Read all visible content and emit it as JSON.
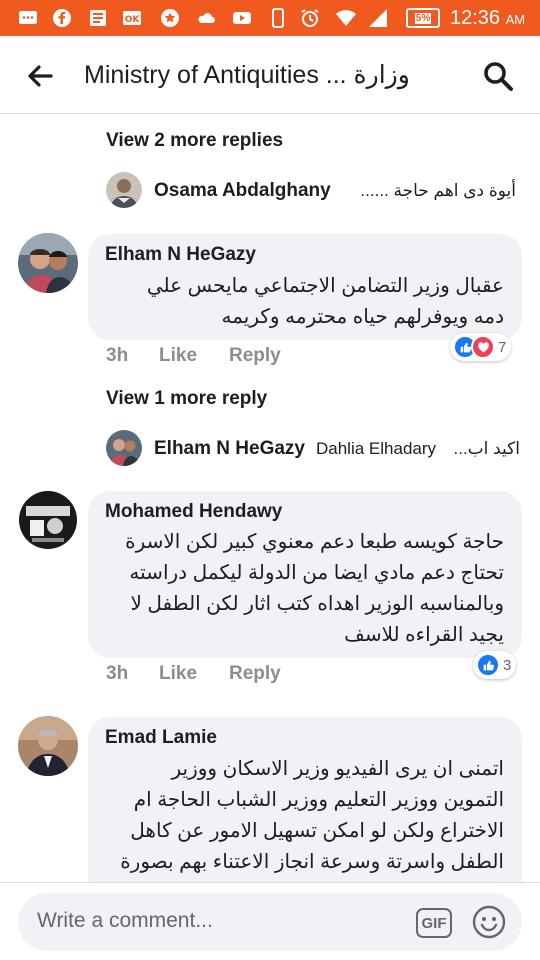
{
  "status_bar": {
    "time": "12:36",
    "ampm": "AM",
    "battery": "5%",
    "icons": [
      "message-icon",
      "facebook-icon",
      "news-icon",
      "ok-icon",
      "star-icon",
      "cloud-icon",
      "youtube-icon",
      "phone-icon",
      "alarm-icon",
      "wifi-icon",
      "signal-icon"
    ]
  },
  "header": {
    "title": "Ministry of Antiquities ... وزارة"
  },
  "thread": {
    "view_more_1": "View 2 more replies",
    "reply_1": {
      "name": "Osama Abdalghany",
      "text": "أيوة دى اهم حاجة ......"
    },
    "comment_1": {
      "name": "Elham N HeGazy",
      "lines": [
        "عقبال وزير التضامن الاجتماعي مايحس علي",
        "دمه ويوفرلهم حياه محترمه وكريمه"
      ],
      "time": "3h",
      "like": "Like",
      "reply": "Reply",
      "reaction_count": "7"
    },
    "view_more_2": "View 1 more reply",
    "reply_2": {
      "name": "Elham N HeGazy",
      "mention": "Dahlia Elhadary",
      "text": "اكيد اب..."
    },
    "comment_2": {
      "name": "Mohamed Hendawy",
      "lines": [
        "حاجة كويسه طبعا دعم معنوي كبير لكن الاسرة",
        "تحتاج دعم مادي ايضا من الدولة ليكمل دراسته",
        "وبالمناسبه الوزير اهداه كتب اثار لكن الطفل لا",
        "يجيد القراءه للاسف"
      ],
      "time": "3h",
      "like": "Like",
      "reply": "Reply",
      "reaction_count": "3"
    },
    "comment_3": {
      "name": "Emad Lamie",
      "lines": [
        "اتمنى ان يرى الفيديو وزير الاسكان ووزير",
        "التموين ووزير التعليم ووزير الشباب الحاجة ام",
        "الاختراع ولكن لو امكن تسهيل الامور عن كاهل",
        "الطفل واسرتة وسرعة انجاز الاعتناء بهم بصورة"
      ]
    }
  },
  "composer": {
    "placeholder": "Write a comment...",
    "gif_label": "GIF"
  },
  "colors": {
    "status_bar": "#f05a1e",
    "bubble": "#f0f2f5",
    "like_blue": "#1877f2",
    "love_red": "#f33e58",
    "muted_text": "#8a8d91"
  }
}
